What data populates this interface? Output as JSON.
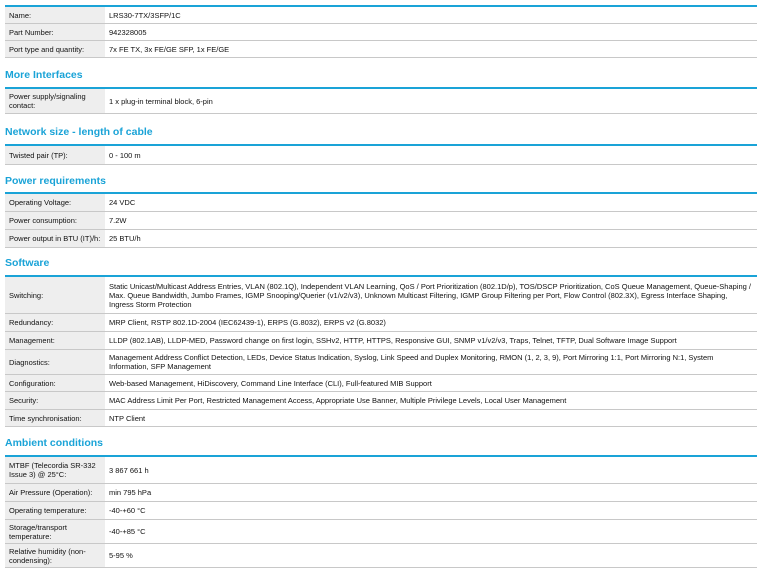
{
  "top": {
    "rows": [
      {
        "label": "Name:",
        "value": "LRS30-7TX/3SFP/1C"
      },
      {
        "label": "Part Number:",
        "value": "942328005"
      },
      {
        "label": "Port type and quantity:",
        "value": "7x FE TX, 3x FE/GE SFP, 1x FE/GE"
      }
    ]
  },
  "more_interfaces": {
    "title": "More Interfaces",
    "rows": [
      {
        "label": "Power supply/signaling contact:",
        "value": "1 x plug-in terminal block, 6-pin"
      }
    ]
  },
  "network_size": {
    "title": "Network size - length of cable",
    "rows": [
      {
        "label": "Twisted pair (TP):",
        "value": "0 - 100 m"
      }
    ]
  },
  "power": {
    "title": "Power requirements",
    "rows": [
      {
        "label": "Operating Voltage:",
        "value": "24 VDC"
      },
      {
        "label": "Power consumption:",
        "value": "7.2W"
      },
      {
        "label": "Power output in BTU (IT)/h:",
        "value": "25 BTU/h"
      }
    ]
  },
  "software": {
    "title": "Software",
    "rows": [
      {
        "label": "Switching:",
        "value": "Static Unicast/Multicast Address Entries, VLAN (802.1Q), Independent VLAN Learning, QoS / Port Prioritization (802.1D/p), TOS/DSCP Prioritization, CoS Queue Management, Queue-Shaping / Max. Queue Bandwidth, Jumbo Frames, IGMP Snooping/Querier (v1/v2/v3), Unknown Multicast Filtering, IGMP Group Filtering per Port, Flow Control (802.3X), Egress Interface Shaping, Ingress Storm Protection"
      },
      {
        "label": "Redundancy:",
        "value": "MRP Client, RSTP 802.1D-2004 (IEC62439-1), ERPS (G.8032), ERPS v2 (G.8032)"
      },
      {
        "label": "Management:",
        "value": "LLDP (802.1AB), LLDP-MED, Password change on first login, SSHv2, HTTP, HTTPS, Responsive GUI, SNMP v1/v2/v3, Traps, Telnet, TFTP, Dual Software Image Support"
      },
      {
        "label": "Diagnostics:",
        "value": "Management Address Conflict Detection, LEDs, Device Status Indication, Syslog, Link Speed and Duplex Monitoring, RMON (1, 2, 3, 9), Port Mirroring 1:1, Port Mirroring N:1, System Information, SFP Management"
      },
      {
        "label": "Configuration:",
        "value": "Web-based Management, HiDiscovery, Command Line Interface (CLI), Full-featured MIB Support"
      },
      {
        "label": "Security:",
        "value": "MAC Address Limit Per Port, Restricted Management Access, Appropriate Use Banner, Multiple Privilege Levels, Local User Management"
      },
      {
        "label": "Time synchronisation:",
        "value": "NTP Client"
      }
    ]
  },
  "ambient": {
    "title": "Ambient conditions",
    "rows": [
      {
        "label": "MTBF (Telecordia SR-332 Issue 3) @ 25°C:",
        "value": "3 867 661 h"
      },
      {
        "label": "Air Pressure (Operation):",
        "value": "min 795 hPa"
      },
      {
        "label": "Operating temperature:",
        "value": "-40-+60 °C"
      },
      {
        "label": "Storage/transport temperature:",
        "value": "-40-+85 °C"
      },
      {
        "label": "Relative humidity (non-condensing):",
        "value": "5-95 %"
      }
    ]
  }
}
